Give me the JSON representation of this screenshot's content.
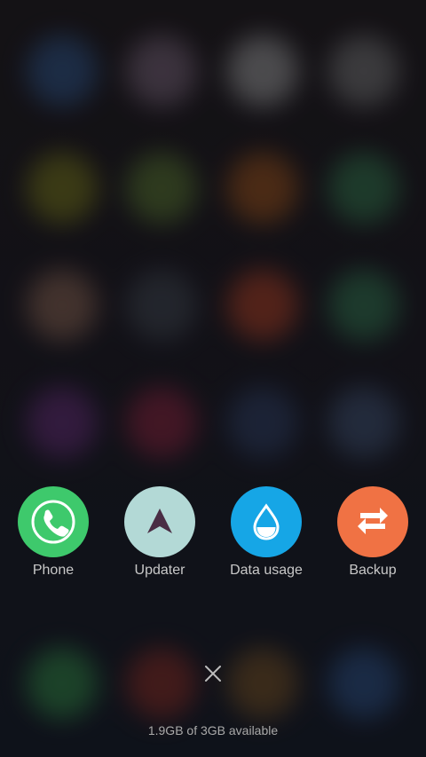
{
  "recent_apps": [
    {
      "label": "Phone",
      "color": "#3ec96c",
      "icon": "phone-icon"
    },
    {
      "label": "Updater",
      "color": "#b3d9d6",
      "icon": "updater-arrow-icon"
    },
    {
      "label": "Data usage",
      "color": "#16a6e6",
      "icon": "water-drop-icon"
    },
    {
      "label": "Backup",
      "color": "#f07244",
      "icon": "transfer-arrows-icon"
    }
  ],
  "close_icon": "close-icon",
  "memory_status": "1.9GB of 3GB available"
}
